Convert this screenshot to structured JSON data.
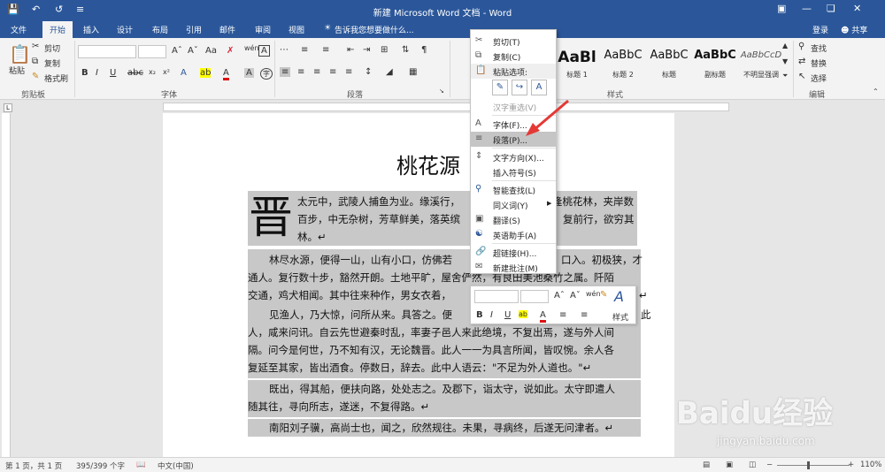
{
  "titlebar": {
    "title": "新建 Microsoft Word 文档 - Word",
    "quick_save_icon": "save-icon",
    "quick_undo_icon": "undo-icon",
    "quick_redo_icon": "redo-icon"
  },
  "menubar": {
    "tabs": [
      "文件",
      "开始",
      "插入",
      "设计",
      "布局",
      "引用",
      "邮件",
      "审阅",
      "视图"
    ],
    "tell_me": "告诉我您想要做什么...",
    "login": "登录",
    "share": "共享"
  },
  "ribbon": {
    "clipboard": {
      "paste": "粘贴",
      "cut": "剪切",
      "copy": "复制",
      "format_painter": "格式刷",
      "group": "剪贴板"
    },
    "font_group": "字体",
    "paragraph_group": "段落",
    "styles_group": "样式",
    "editing": {
      "find": "查找",
      "replace": "替换",
      "select": "选择",
      "group": "编辑"
    },
    "styles": [
      {
        "sample": "AaBl",
        "name": "标题 1"
      },
      {
        "sample": "AaBbC",
        "name": "标题 2"
      },
      {
        "sample": "AaBbC",
        "name": "标题"
      },
      {
        "sample": "AaBbC",
        "name": "副标题"
      },
      {
        "sample": "AaBbCcD",
        "name": "不明显强调"
      }
    ]
  },
  "document": {
    "title": "桃花源",
    "drop_cap": "晋",
    "lines": [
      "太元中，武陵人捕鱼为业。缘溪行，",
      "逢桃花林，夹岸数",
      "百步，中无杂树，芳草鲜美，落英缤",
      "复前行，欲穷其",
      "林。↵",
      "林尽水源，便得一山，山有小口，仿佛若",
      "口入。初极狭，才",
      "通人。复行数十步，豁然开朗。土地平旷，屋舍俨然，有良田美池桑竹之属。阡陌",
      "交通，鸡犬相闻。其中往来种作，男女衣着，",
      "↵",
      "见渔人，乃大惊，问所从来。具答之。便",
      "此",
      "人，咸来问讯。自云先世避秦时乱，率妻子邑人来此绝境，不复出焉，遂与外人间",
      "隔。问今是何世，乃不知有汉，无论魏晋。此人一一为具言所闻，皆叹惋。余人各",
      "复延至其家，皆出酒食。停数日，辞去。此中人语云：\"不足为外人道也。\"↵",
      "既出，得其船，便扶向路，处处志之。及郡下，诣太守，说如此。太守即遣人",
      "随其往，寻向所志，遂迷，不复得路。↵",
      "南阳刘子骥，高尚士也，闻之，欣然规往。未果，寻病终，后遂无问津者。↵"
    ]
  },
  "context_menu": {
    "cut": "剪切(T)",
    "copy": "复制(C)",
    "paste_options": "粘贴选项:",
    "reconvert": "汉字重选(V)",
    "font": "字体(F)...",
    "paragraph": "段落(P)...",
    "text_direction": "文字方向(X)...",
    "insert_symbol": "插入符号(S)",
    "smart_lookup": "智能查找(L)",
    "synonyms": "同义词(Y)",
    "translate": "翻译(S)",
    "english_assistant": "英语助手(A)",
    "hyperlink": "超链接(H)...",
    "new_comment": "新建批注(M)"
  },
  "mini_toolbar": {
    "styles": "样式"
  },
  "statusbar": {
    "page": "第 1 页，共 1 页",
    "words": "395/399 个字",
    "language": "中文(中国)",
    "zoom": "110%"
  },
  "watermark": {
    "big": "Baidu经验",
    "small": "jingyan.baidu.com"
  },
  "colors": {
    "accent": "#2b579a",
    "highlight": "#c8c8c8",
    "arrow": "#e53935"
  }
}
